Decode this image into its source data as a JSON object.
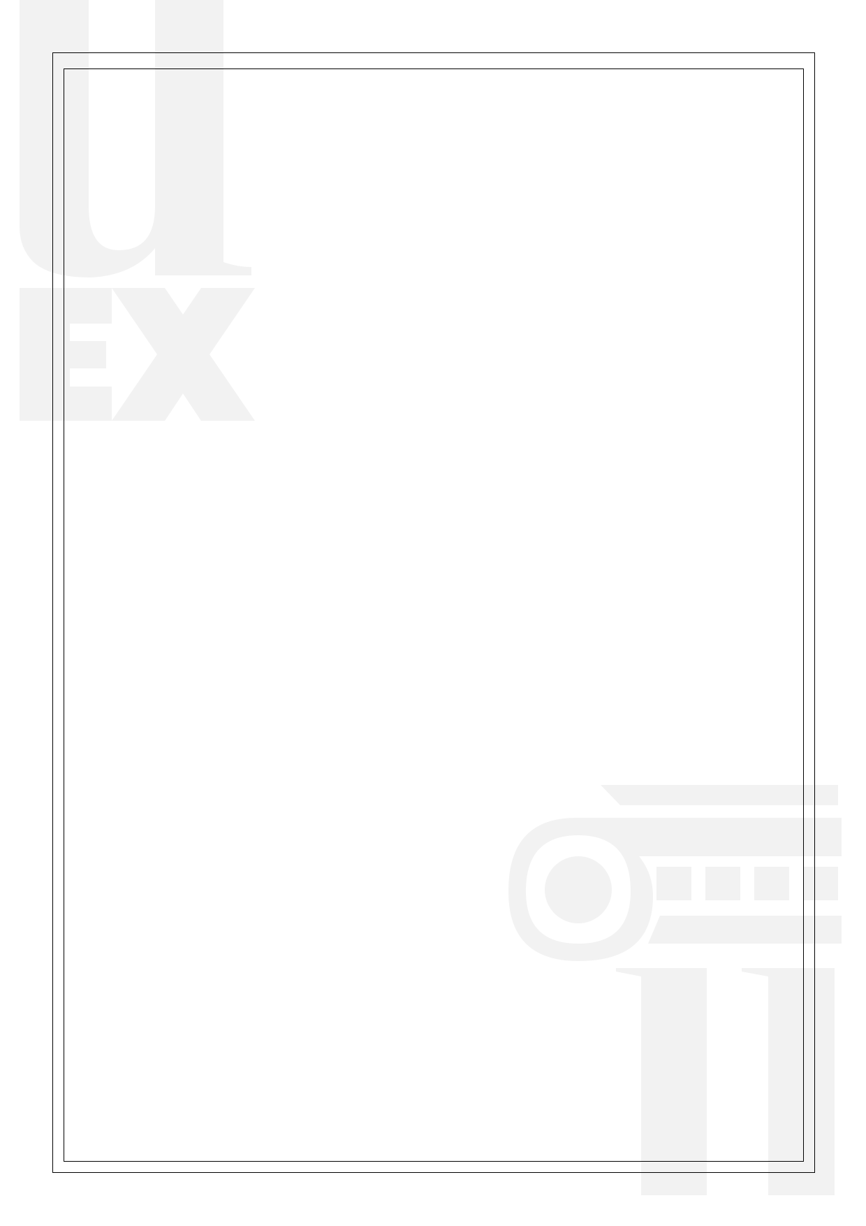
{
  "page": {
    "watermark_brand": "uex",
    "watermark_icon": "ionic-column-capital-icon",
    "colors": {
      "background": "#ffffff",
      "watermark": "#f2f2f2",
      "frame": "#000000"
    }
  }
}
